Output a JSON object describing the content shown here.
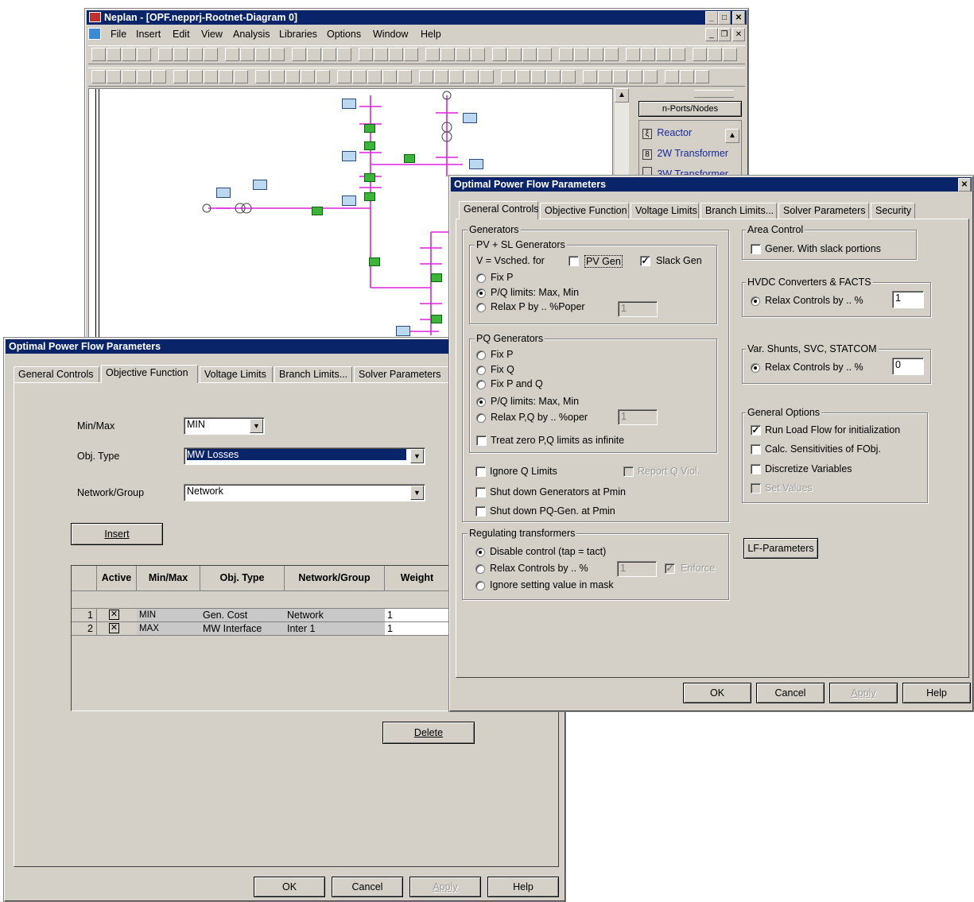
{
  "neplan": {
    "title": "Neplan - [OPF.nepprj-Rootnet-Diagram 0]",
    "menus": [
      "File",
      "Insert",
      "Edit",
      "View",
      "Analysis",
      "Libraries",
      "Options",
      "Window",
      "Help"
    ],
    "palette": {
      "header": "n-Ports/Nodes",
      "items": [
        "Reactor",
        "2W Transformer",
        "3W Transformer"
      ]
    }
  },
  "obj_dialog": {
    "title": "Optimal Power Flow Parameters",
    "tabs": [
      "General Controls",
      "Objective Function",
      "Voltage Limits",
      "Branch Limits...",
      "Solver Parameters"
    ],
    "minmax_label": "Min/Max",
    "minmax_value": "MIN",
    "objtype_label": "Obj. Type",
    "objtype_value": "MW Losses",
    "netgroup_label": "Network/Group",
    "netgroup_value": "Network",
    "insert_label": "Insert",
    "delete_label": "Delete",
    "columns": [
      "Active",
      "Min/Max",
      "Obj. Type",
      "Network/Group",
      "Weight"
    ],
    "rows": [
      {
        "num": "1",
        "active": true,
        "minmax": "MIN",
        "objtype": "Gen. Cost",
        "network": "Network",
        "weight": "1"
      },
      {
        "num": "2",
        "active": true,
        "minmax": "MAX",
        "objtype": "MW Interface",
        "network": "Inter 1",
        "weight": "1"
      }
    ],
    "buttons": {
      "ok": "OK",
      "cancel": "Cancel",
      "apply": "Apply",
      "help": "Help"
    }
  },
  "gen_dialog": {
    "title": "Optimal Power Flow Parameters",
    "tabs": [
      "General Controls",
      "Objective Function",
      "Voltage Limits",
      "Branch Limits...",
      "Solver Parameters",
      "Security"
    ],
    "generators": {
      "label": "Generators",
      "pvsl": {
        "label": "PV + SL Generators",
        "vsched": "V = Vsched. for",
        "pv_gen": "PV Gen",
        "slack_gen": "Slack Gen",
        "fix_p": "Fix P",
        "pq_limits": "P/Q limits: Max, Min",
        "relax_p": "Relax P by .. %Poper",
        "relax_value": "1"
      },
      "pq": {
        "label": "PQ Generators",
        "fix_p": "Fix P",
        "fix_q": "Fix Q",
        "fix_pq": "Fix P and Q",
        "pq_limits": "P/Q limits: Max, Min",
        "relax_pq": "Relax P,Q by .. %oper",
        "relax_value": "1",
        "treat_zero": "Treat zero P,Q limits as infinite"
      },
      "ignore_q": "Ignore Q Limits",
      "report_q": "Report Q Viol.",
      "shut_gen": "Shut down Generators at Pmin",
      "shut_pq": "Shut down PQ-Gen. at Pmin"
    },
    "regulating": {
      "label": "Regulating transformers",
      "disable": "Disable control (tap = tact)",
      "relax": "Relax Controls by .. %",
      "relax_value": "1",
      "enforce": "Enforce",
      "ignore": "Ignore setting value in mask"
    },
    "area": {
      "label": "Area Control",
      "gener": "Gener. With slack portions"
    },
    "hvdc": {
      "label": "HVDC Converters & FACTS",
      "relax": "Relax Controls by .. %",
      "value": "1"
    },
    "varshunts": {
      "label": "Var. Shunts, SVC, STATCOM",
      "relax": "Relax Controls by .. %",
      "value": "0"
    },
    "general_options": {
      "label": "General Options",
      "run_lf": "Run Load Flow for initialization",
      "calc_sens": "Calc. Sensitivities of FObj.",
      "discretize": "Discretize Variables",
      "set_values": "Set Values"
    },
    "lf_params": "LF-Parameters",
    "buttons": {
      "ok": "OK",
      "cancel": "Cancel",
      "apply": "Apply",
      "help": "Help"
    }
  }
}
